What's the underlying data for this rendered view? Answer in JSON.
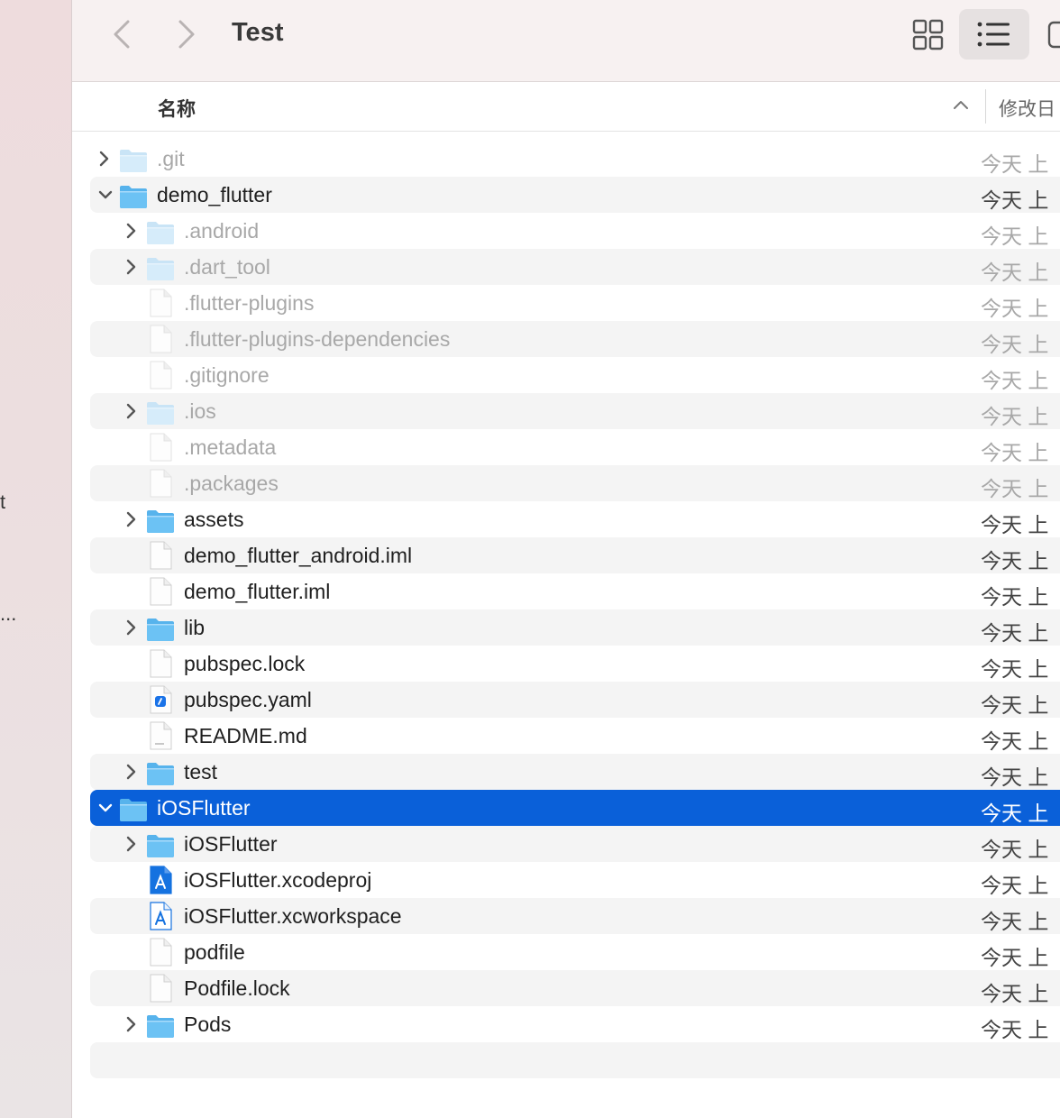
{
  "window": {
    "title": "Test"
  },
  "sidebar": {
    "fragments": [
      "t",
      "..."
    ]
  },
  "toolbar": {
    "back_icon": "chevron-left-icon",
    "forward_icon": "chevron-right-icon",
    "view_grid_icon": "grid-view-icon",
    "view_list_icon": "list-view-icon",
    "view_column_icon": "column-view-icon"
  },
  "columns": {
    "name": "名称",
    "date": "修改日"
  },
  "colors": {
    "selection": "#0a60d9",
    "folder": "#4aaee8"
  },
  "files": [
    {
      "name": ".git",
      "date": "今天 上",
      "type": "folder",
      "level": 0,
      "expanded": false,
      "dim": true,
      "alt": false,
      "selected": false
    },
    {
      "name": "demo_flutter",
      "date": "今天 上",
      "type": "folder",
      "level": 0,
      "expanded": true,
      "dim": false,
      "alt": true,
      "selected": false
    },
    {
      "name": ".android",
      "date": "今天 上",
      "type": "folder",
      "level": 1,
      "expanded": false,
      "dim": true,
      "alt": false,
      "selected": false
    },
    {
      "name": ".dart_tool",
      "date": "今天 上",
      "type": "folder",
      "level": 1,
      "expanded": false,
      "dim": true,
      "alt": true,
      "selected": false
    },
    {
      "name": ".flutter-plugins",
      "date": "今天 上",
      "type": "file",
      "level": 1,
      "dim": true,
      "alt": false,
      "selected": false
    },
    {
      "name": ".flutter-plugins-dependencies",
      "date": "今天 上",
      "type": "file",
      "level": 1,
      "dim": true,
      "alt": true,
      "selected": false
    },
    {
      "name": ".gitignore",
      "date": "今天 上",
      "type": "file",
      "level": 1,
      "dim": true,
      "alt": false,
      "selected": false
    },
    {
      "name": ".ios",
      "date": "今天 上",
      "type": "folder",
      "level": 1,
      "expanded": false,
      "dim": true,
      "alt": true,
      "selected": false
    },
    {
      "name": ".metadata",
      "date": "今天 上",
      "type": "file",
      "level": 1,
      "dim": true,
      "alt": false,
      "selected": false
    },
    {
      "name": ".packages",
      "date": "今天 上",
      "type": "file",
      "level": 1,
      "dim": true,
      "alt": true,
      "selected": false
    },
    {
      "name": "assets",
      "date": "今天 上",
      "type": "folder",
      "level": 1,
      "expanded": false,
      "dim": false,
      "alt": false,
      "selected": false
    },
    {
      "name": "demo_flutter_android.iml",
      "date": "今天 上",
      "type": "file",
      "level": 1,
      "dim": false,
      "alt": true,
      "selected": false
    },
    {
      "name": "demo_flutter.iml",
      "date": "今天 上",
      "type": "file",
      "level": 1,
      "dim": false,
      "alt": false,
      "selected": false
    },
    {
      "name": "lib",
      "date": "今天 上",
      "type": "folder",
      "level": 1,
      "expanded": false,
      "dim": false,
      "alt": true,
      "selected": false
    },
    {
      "name": "pubspec.lock",
      "date": "今天 上",
      "type": "file",
      "level": 1,
      "dim": false,
      "alt": false,
      "selected": false
    },
    {
      "name": "pubspec.yaml",
      "date": "今天 上",
      "type": "yaml",
      "level": 1,
      "dim": false,
      "alt": true,
      "selected": false
    },
    {
      "name": "README.md",
      "date": "今天 上",
      "type": "md",
      "level": 1,
      "dim": false,
      "alt": false,
      "selected": false
    },
    {
      "name": "test",
      "date": "今天 上",
      "type": "folder",
      "level": 1,
      "expanded": false,
      "dim": false,
      "alt": true,
      "selected": false
    },
    {
      "name": "iOSFlutter",
      "date": "今天 上",
      "type": "folder",
      "level": 0,
      "expanded": true,
      "dim": false,
      "alt": false,
      "selected": true
    },
    {
      "name": "iOSFlutter",
      "date": "今天 上",
      "type": "folder",
      "level": 1,
      "expanded": false,
      "dim": false,
      "alt": true,
      "selected": false
    },
    {
      "name": "iOSFlutter.xcodeproj",
      "date": "今天 上",
      "type": "xcodeproj",
      "level": 1,
      "dim": false,
      "alt": false,
      "selected": false
    },
    {
      "name": "iOSFlutter.xcworkspace",
      "date": "今天 上",
      "type": "xcworkspace",
      "level": 1,
      "dim": false,
      "alt": true,
      "selected": false
    },
    {
      "name": "podfile",
      "date": "今天 上",
      "type": "file",
      "level": 1,
      "dim": false,
      "alt": false,
      "selected": false
    },
    {
      "name": "Podfile.lock",
      "date": "今天 上",
      "type": "file",
      "level": 1,
      "dim": false,
      "alt": true,
      "selected": false
    },
    {
      "name": "Pods",
      "date": "今天 上",
      "type": "folder",
      "level": 1,
      "expanded": false,
      "dim": false,
      "alt": false,
      "selected": false
    }
  ]
}
